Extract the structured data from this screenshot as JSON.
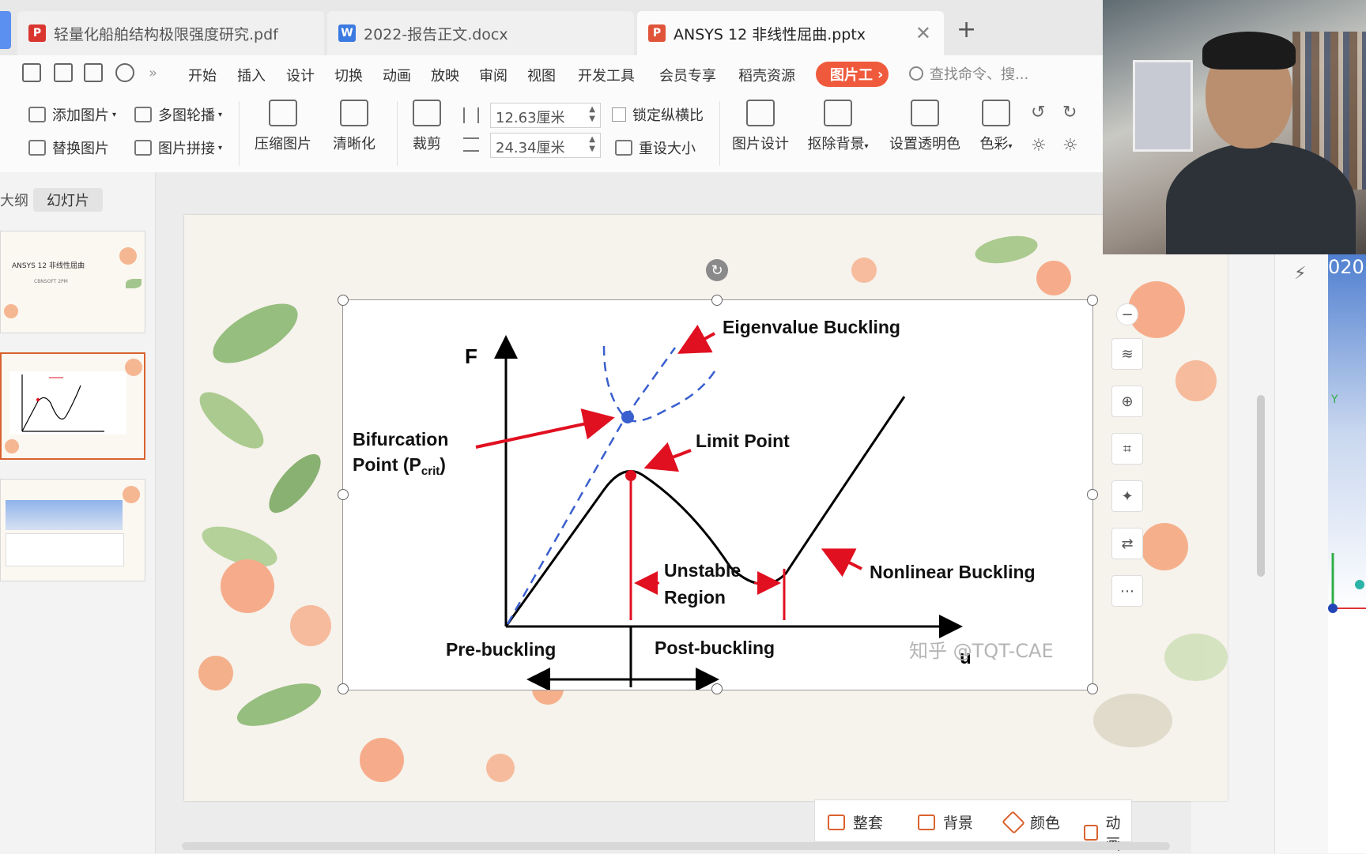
{
  "tabs": [
    {
      "label": "轻量化船舶结构极限强度研究.pdf",
      "icon_color": "#d9362f",
      "icon_glyph": "P"
    },
    {
      "label": "2022-报告正文.docx",
      "icon_color": "#3b7ae0",
      "icon_glyph": "W"
    },
    {
      "label": "ANSYS 12 非线性屈曲.pptx",
      "icon_color": "#e0553a",
      "icon_glyph": "P"
    }
  ],
  "new_tab": "+",
  "menu": {
    "items": [
      "开始",
      "插入",
      "设计",
      "切换",
      "动画",
      "放映",
      "审阅",
      "视图",
      "开发工具",
      "会员专享",
      "稻壳资源"
    ],
    "active_tool": "图片工",
    "more": "»",
    "search_placeholder": "查找命令、搜..."
  },
  "ribbon": {
    "add_picture": "添加图片",
    "carousel": "多图轮播",
    "replace_picture": "替换图片",
    "collage": "图片拼接",
    "compress": "压缩图片",
    "sharpen": "清晰化",
    "crop": "裁剪",
    "height_value": "12.63厘米",
    "width_value": "24.34厘米",
    "lock_ratio": "锁定纵横比",
    "reset_size": "重设大小",
    "picture_design": "图片设计",
    "remove_bg": "抠除背景",
    "set_transparent": "设置透明色",
    "color": "色彩"
  },
  "panel": {
    "tab_outline": "大纲",
    "tab_slides": "幻灯片",
    "thumb1_title": "ANSYS 12 非线性屈曲",
    "thumb1_sub": "CBNSOFT 2PM"
  },
  "chart_data": {
    "type": "line",
    "title": "",
    "xlabel": "u",
    "ylabel": "F",
    "series": [],
    "annotations": [
      "Eigenvalue Buckling",
      "Bifurcation",
      "Point (P",
      "crit",
      ")",
      "Limit Point",
      "Unstable",
      "Region",
      "Nonlinear Buckling",
      "Pre-buckling",
      "Post-buckling"
    ],
    "watermark": "知乎 @TQT-CAE"
  },
  "bottom_bar": {
    "full_set": "整套",
    "background": "背景",
    "color": "颜色",
    "animation": "动画"
  },
  "right_panel": {
    "ansys_text": "020",
    "axis_y": "Y"
  },
  "colors": {
    "accent": "#f05a3c",
    "curve": "#000000",
    "annotation_red": "#e01020",
    "eigen_blue": "#3a5fcf"
  }
}
